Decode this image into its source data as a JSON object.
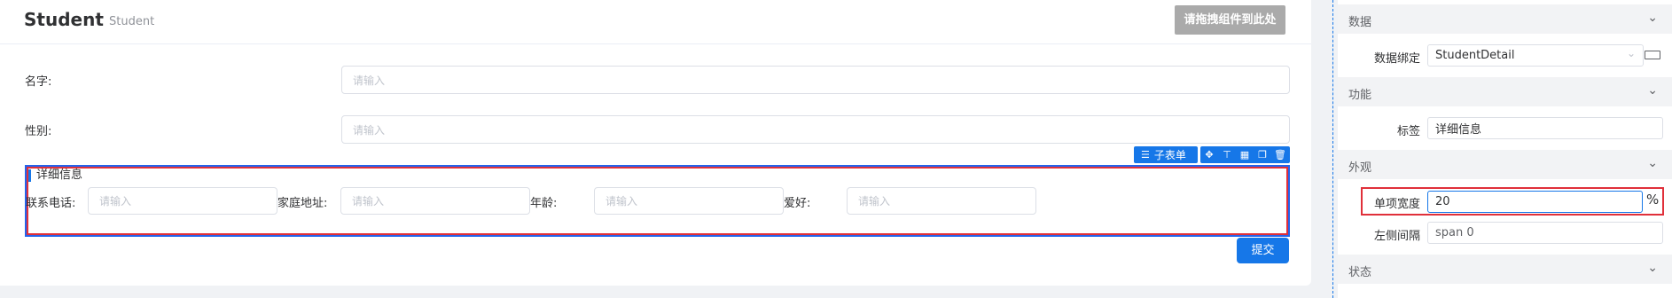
{
  "header": {
    "title": "Student",
    "subtitle": "Student",
    "drop_button": "请拖拽组件到此处"
  },
  "form": {
    "name_label": "名字:",
    "name_placeholder": "请输入",
    "gender_label": "性别:",
    "gender_placeholder": "请输入",
    "subform": {
      "toolbar_label": "子表单",
      "title": "详细信息",
      "fields": [
        {
          "label": "联系电话:",
          "placeholder": "请输入"
        },
        {
          "label": "家庭地址:",
          "placeholder": "请输入"
        },
        {
          "label": "年龄:",
          "placeholder": "请输入"
        },
        {
          "label": "爱好:",
          "placeholder": "请输入"
        }
      ]
    },
    "submit_label": "提交"
  },
  "panel": {
    "sections": {
      "data": "数据",
      "function": "功能",
      "appearance": "外观",
      "status": "状态"
    },
    "data_binding_label": "数据绑定",
    "data_binding_value": "StudentDetail",
    "tag_label": "标签",
    "tag_value": "详细信息",
    "item_width_label": "单项宽度",
    "item_width_value": "20",
    "item_width_unit": "%",
    "left_gap_label": "左侧间隔",
    "left_gap_placeholder": "span 0"
  },
  "colors": {
    "primary": "#1677e8",
    "highlight_red": "#e0303a",
    "drop_button_bg": "#aaaaaa"
  }
}
